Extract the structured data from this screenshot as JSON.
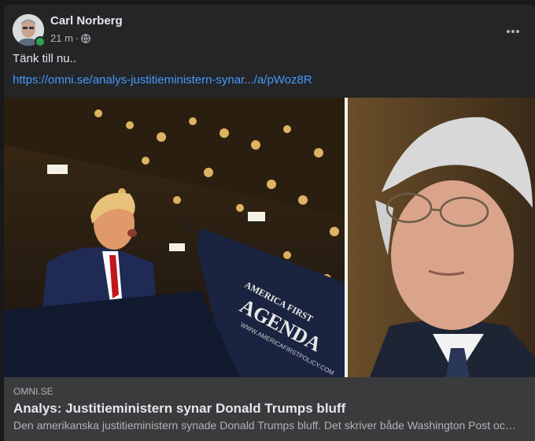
{
  "post": {
    "author": "Carl Norberg",
    "time": "21 m",
    "separator": "·",
    "privacy_icon": "globe-icon",
    "more_icon": "more-horizontal-icon",
    "text": "Tänk till nu..",
    "link": "https://omni.se/analys-justitieministern-synar.../a/pWoz8R",
    "online": true
  },
  "image": {
    "podium_text_1": "AMERICA FIRST",
    "podium_text_2": "AGENDA",
    "podium_text_3": "WWW.AMERICAFIRSTPOLICY.COM"
  },
  "preview": {
    "domain": "OMNI.SE",
    "title": "Analys: Justitieministern synar Donald Trumps bluff",
    "description": "Den amerikanska justitieministern synade Donald Trumps bluff. Det skriver både Washington Post och New York Times."
  },
  "colors": {
    "background": "#18191a",
    "card": "#242526",
    "preview_bg": "#3a3b3c",
    "link": "#4599ff",
    "online": "#31a24c"
  }
}
